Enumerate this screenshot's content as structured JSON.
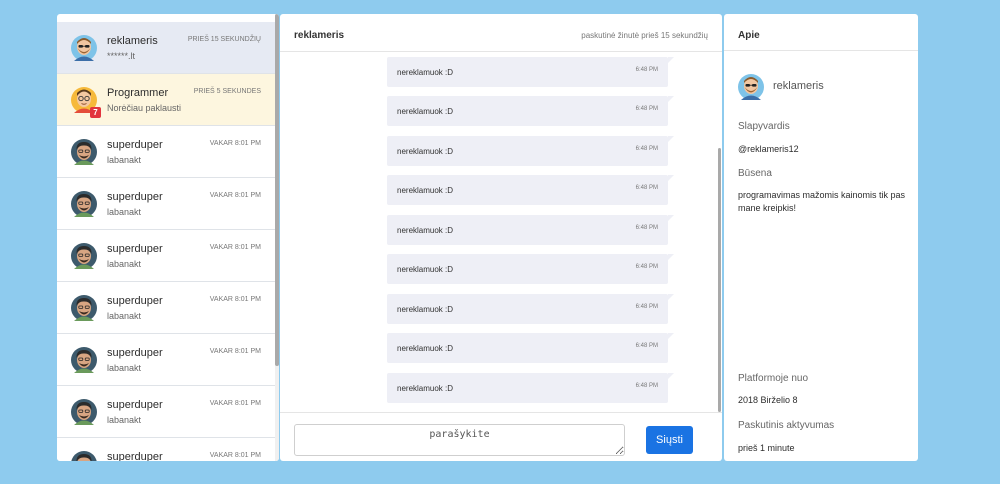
{
  "conversations": [
    {
      "name": "reklameris",
      "preview": "******.lt",
      "time": "PRIEŠ 15 SEKUNDŽIŲ",
      "state": "active"
    },
    {
      "name": "Programmer",
      "preview": "Norėčiau paklausti",
      "time": "PRIEŠ 5 SEKUNDES",
      "state": "unread",
      "badge": "7"
    },
    {
      "name": "superduper",
      "preview": "labanakt",
      "time": "VAKAR 8:01 PM"
    },
    {
      "name": "superduper",
      "preview": "labanakt",
      "time": "VAKAR 8:01 PM"
    },
    {
      "name": "superduper",
      "preview": "labanakt",
      "time": "VAKAR 8:01 PM"
    },
    {
      "name": "superduper",
      "preview": "labanakt",
      "time": "VAKAR 8:01 PM"
    },
    {
      "name": "superduper",
      "preview": "labanakt",
      "time": "VAKAR 8:01 PM"
    },
    {
      "name": "superduper",
      "preview": "labanakt",
      "time": "VAKAR 8:01 PM"
    },
    {
      "name": "superduper",
      "preview": "",
      "time": "VAKAR 8:01 PM"
    }
  ],
  "chat": {
    "title": "reklameris",
    "last_message": "paskutinė žinutė prieš 15 sekundžių",
    "messages": [
      {
        "text": "nereklamuok :D",
        "time": "6:48 PM"
      },
      {
        "text": "nereklamuok :D",
        "time": "6:48 PM"
      },
      {
        "text": "nereklamuok :D",
        "time": "6:48 PM"
      },
      {
        "text": "nereklamuok :D",
        "time": "6:48 PM"
      },
      {
        "text": "nereklamuok :D",
        "time": "6:48 PM"
      },
      {
        "text": "nereklamuok :D",
        "time": "6:48 PM"
      },
      {
        "text": "nereklamuok :D",
        "time": "6:48 PM"
      },
      {
        "text": "nereklamuok :D",
        "time": "6:48 PM"
      },
      {
        "text": "nereklamuok :D",
        "time": "6:48 PM"
      }
    ],
    "input_placeholder": "parašykite",
    "send_label": "Siųsti"
  },
  "about": {
    "title": "Apie",
    "name": "reklameris",
    "username_label": "Slapyvardis",
    "username": "@reklameris12",
    "status_label": "Būsena",
    "status": "programavimas mažomis kainomis tik pas mane kreipkis!",
    "joined_label": "Platformoje nuo",
    "joined": "2018 Birželio 8",
    "last_active_label": "Paskutinis aktyvumas",
    "last_active": "prieš 1 minute"
  },
  "colors": {
    "background": "#8ecbee",
    "accent": "#1a73e3",
    "badge": "#e2343e",
    "active_row": "#e6eaf3",
    "unread_row": "#fdf6df",
    "message_bubble": "#eeeff6"
  },
  "icons": {
    "avatar_a": "bearded-man-sunglasses-avatar-icon",
    "avatar_b": "man-glasses-avatar-icon",
    "avatar_c": "curly-hair-man-avatar-icon"
  }
}
